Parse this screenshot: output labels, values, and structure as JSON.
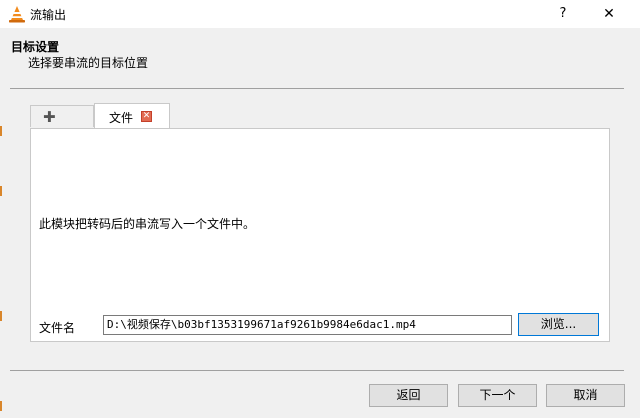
{
  "window": {
    "title": "流输出",
    "help_label": "?",
    "close_label": "✕",
    "icon": "vlc-cone-icon"
  },
  "header": {
    "title": "目标设置",
    "subtitle": "选择要串流的目标位置"
  },
  "tabs": {
    "add_icon": "plus-icon",
    "active_label": "文件",
    "close_icon": "tab-close-icon"
  },
  "panel": {
    "description": "此模块把转码后的串流写入一个文件中。",
    "filename_label": "文件名",
    "filename_value": "D:\\视频保存\\b03bf1353199671af9261b9984e6dac1.mp4",
    "browse_label": "浏览..."
  },
  "footer": {
    "back_label": "返回",
    "next_label": "下一个",
    "cancel_label": "取消"
  },
  "colors": {
    "vlc_orange": "#f28b1c",
    "tab_close_red": "#e16b52",
    "focus_border": "#0078d7"
  }
}
